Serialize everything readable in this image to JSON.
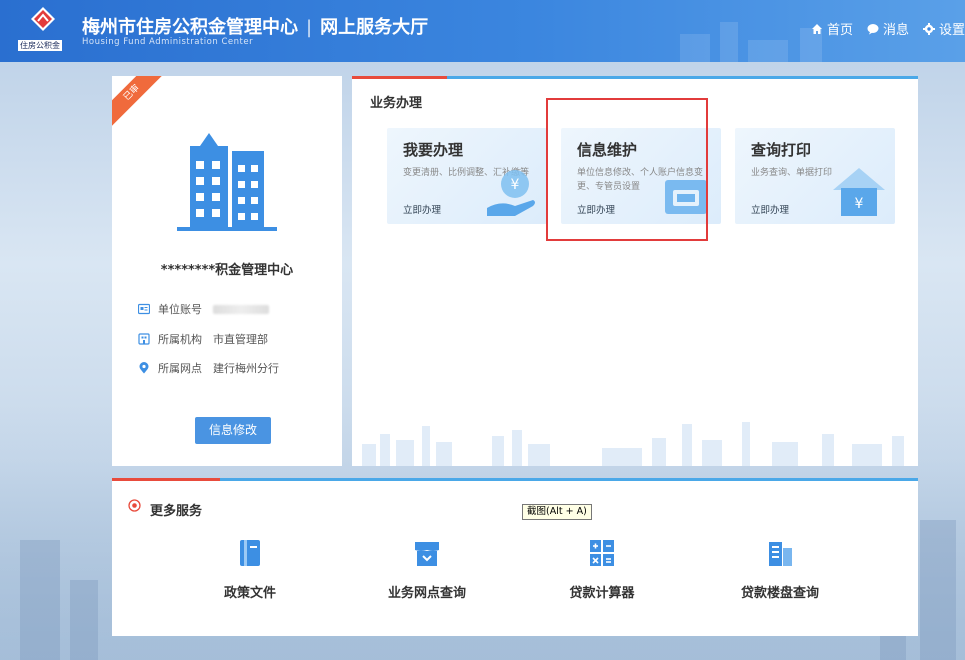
{
  "header": {
    "logo_text": "住房公积金",
    "title": "梅州市住房公积金管理中心",
    "separator": "|",
    "subtitle_cn": "网上服务大厅",
    "subtitle_en": "Housing Fund Administration Center",
    "nav": [
      {
        "label": "首页",
        "icon": "home-icon"
      },
      {
        "label": "消息",
        "icon": "message-icon"
      },
      {
        "label": "设置",
        "icon": "gear-icon"
      }
    ]
  },
  "profile": {
    "ribbon": "已审",
    "org_name": "********积金管理中心",
    "rows": [
      {
        "label": "单位账号",
        "value": "",
        "icon": "account-card-icon"
      },
      {
        "label": "所属机构",
        "value": "市直管理部",
        "icon": "building-small-icon"
      },
      {
        "label": "所属网点",
        "value": "建行梅州分行",
        "icon": "location-pin-icon"
      }
    ],
    "edit_button": "信息修改"
  },
  "business": {
    "title": "业务办理",
    "tiles": [
      {
        "title": "我要办理",
        "desc": "变更清册、比例调整、汇补缴等",
        "link": "立即办理",
        "icon": "yuan-hand-icon"
      },
      {
        "title": "信息维护",
        "desc": "单位信息修改、个人账户信息变更、专管员设置",
        "link": "立即办理",
        "icon": "folder-icon"
      },
      {
        "title": "查询打印",
        "desc": "业务查询、单据打印",
        "link": "立即办理",
        "icon": "yuan-house-icon"
      }
    ]
  },
  "more": {
    "title": "更多服务",
    "items": [
      {
        "label": "政策文件",
        "icon": "policy-book-icon"
      },
      {
        "label": "业务网点查询",
        "icon": "store-icon"
      },
      {
        "label": "贷款计算器",
        "icon": "calculator-icon"
      },
      {
        "label": "贷款楼盘查询",
        "icon": "building-search-icon"
      }
    ]
  },
  "tooltip": "截图(Alt + A)",
  "colors": {
    "header_blue": "#2a6fd0",
    "accent_red": "#e84b3c",
    "accent_blue": "#4aa8e8",
    "icon_blue": "#3d8fe3",
    "button_blue": "#4a94e2"
  }
}
